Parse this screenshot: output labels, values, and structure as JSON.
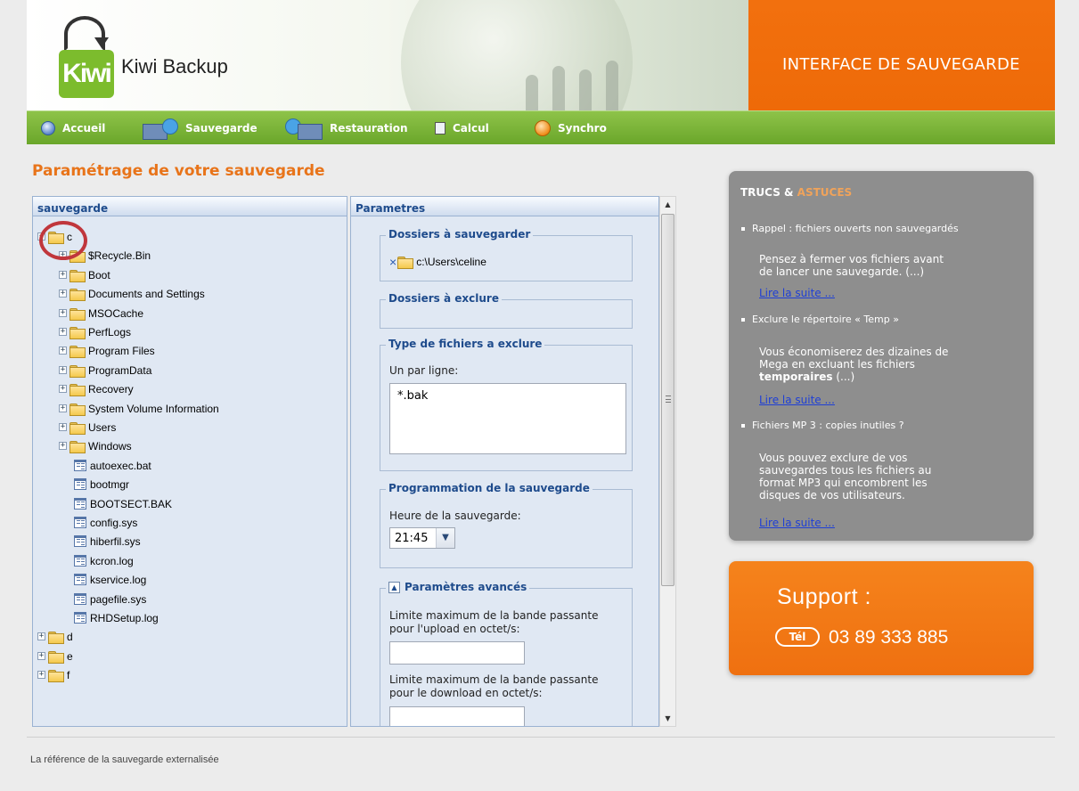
{
  "header": {
    "logo_text": "Kiwi",
    "brand": "Kiwi Backup",
    "banner": "INTERFACE DE SAUVEGARDE"
  },
  "nav": [
    {
      "label": "Accueil",
      "icon": "home-icon"
    },
    {
      "label": "Sauvegarde",
      "icon": "backup-icon"
    },
    {
      "label": "Restauration",
      "icon": "restore-icon"
    },
    {
      "label": "Calcul",
      "icon": "calculator-icon"
    },
    {
      "label": "Synchro",
      "icon": "sync-icon"
    }
  ],
  "page_title": "Paramétrage de votre sauvegarde",
  "tree": {
    "header": "sauvegarde",
    "root": "c",
    "folders": [
      "$Recycle.Bin",
      "Boot",
      "Documents and Settings",
      "MSOCache",
      "PerfLogs",
      "Program Files",
      "ProgramData",
      "Recovery",
      "System Volume Information",
      "Users",
      "Windows"
    ],
    "files": [
      "autoexec.bat",
      "bootmgr",
      "BOOTSECT.BAK",
      "config.sys",
      "hiberfil.sys",
      "kcron.log",
      "kservice.log",
      "pagefile.sys",
      "RHDSetup.log"
    ],
    "drives": [
      "d",
      "e",
      "f"
    ]
  },
  "params": {
    "header": "Parametres",
    "backup_folders": {
      "legend": "Dossiers à sauvegarder",
      "remove_glyph": "×",
      "path": "c:\\Users\\celine"
    },
    "exclude_folders": {
      "legend": "Dossiers à exclure"
    },
    "exclude_types": {
      "legend": "Type de fichiers a exclure",
      "hint": "Un par ligne:",
      "value": "*.bak"
    },
    "schedule": {
      "legend": "Programmation de la sauvegarde",
      "label": "Heure de la sauvegarde:",
      "value": "21:45"
    },
    "advanced": {
      "legend": "Paramètres avancés",
      "upload_label_1": "Limite maximum de la bande passante",
      "upload_label_2": "pour l'upload en octet/s:",
      "upload_value": "",
      "download_label_1": "Limite maximum de la bande passante",
      "download_label_2": "pour le download en octet/s:",
      "download_value": ""
    }
  },
  "tips": {
    "title_1": "TRUCS & ",
    "title_2": "ASTUCES",
    "items": [
      {
        "head": "Rappel : fichiers ouverts non sauvegardés",
        "body_1": "Pensez à fermer vos fichiers avant",
        "body_2": "de lancer une sauvegarde. (...)",
        "link": "Lire la suite ..."
      },
      {
        "head": "Exclure le répertoire « Temp »",
        "body_1": "Vous économiserez des dizaines de",
        "body_2": "Mega en excluant les fichiers",
        "body_3_bold": "temporaires",
        "body_3_rest": " (...)",
        "link": "Lire la suite ..."
      },
      {
        "head": "Fichiers MP 3 : copies inutiles ?",
        "body_1": "Vous pouvez exclure de vos",
        "body_2": "sauvegardes tous les fichiers au",
        "body_3": "format MP3 qui encombrent les",
        "body_4": "disques de vos utilisateurs.",
        "link": "Lire la suite ..."
      }
    ]
  },
  "support": {
    "title": "Support :",
    "tel_label": "Tél",
    "phone": "03 89 333 885"
  },
  "footer": "La référence de la sauvegarde externalisée",
  "colors": {
    "accent_orange": "#ee6a08",
    "nav_green": "#6aa62a",
    "title_orange": "#e8741a",
    "panel_blue": "#e0e8f3",
    "tips_gray": "#8e8e8e",
    "highlight_red": "#c0363c"
  }
}
